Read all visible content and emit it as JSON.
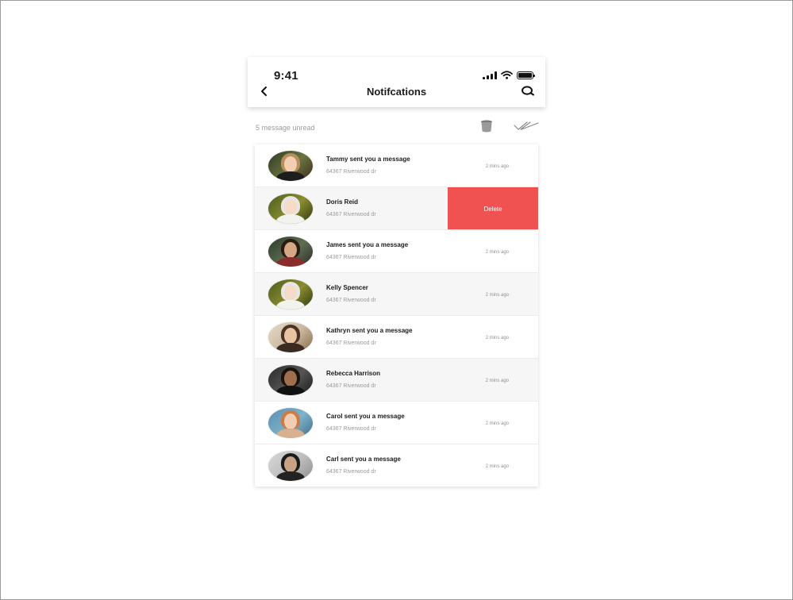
{
  "status_bar": {
    "time": "9:41"
  },
  "header": {
    "title": "Notifcations"
  },
  "toolbar": {
    "unread_text": "5 message unread"
  },
  "notifications": [
    {
      "name": "Tammy sent you a message",
      "address": "64367 Riverwood dr",
      "time": "2 mins ago"
    },
    {
      "name": "Doris Reid",
      "address": "64367 Riverwood dr",
      "time": "",
      "action": "Delete"
    },
    {
      "name": "James sent you a message",
      "address": "64367 Riverwood dr",
      "time": "2 mins ago"
    },
    {
      "name": "Kelly Spencer",
      "address": "64367 Riverwood dr",
      "time": "2 mins ago"
    },
    {
      "name": "Kathryn sent you a message",
      "address": "64367 Riverwood dr",
      "time": "2 mins ago"
    },
    {
      "name": "Rebecca Harrison",
      "address": "64367 Riverwood dr",
      "time": "2 mins ago"
    },
    {
      "name": "Carol sent you a message",
      "address": "64367 Riverwood dr",
      "time": "2 mins ago"
    },
    {
      "name": "Carl sent you a message",
      "address": "64367 Riverwood dr",
      "time": "2 mins ago"
    }
  ],
  "colors": {
    "delete": "#f05252",
    "alt_row": "#f6f6f6",
    "muted_text": "#9a9a9a"
  },
  "icons": [
    "back-icon",
    "search-icon",
    "trash-icon",
    "double-check-icon",
    "signal-icon",
    "wifi-icon",
    "battery-icon"
  ]
}
